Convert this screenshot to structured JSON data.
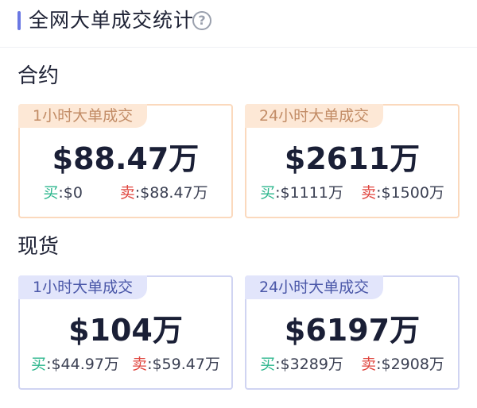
{
  "header": {
    "title": "全网大单成交统计",
    "help_icon": "question-circle-icon",
    "accent_color": "#6a78e3"
  },
  "sections": [
    {
      "title": "合约",
      "cards": [
        {
          "tag": "1小时大单成交",
          "value": "$88.47万",
          "buy_label": "买",
          "buy_value": ":$0",
          "sell_label": "卖",
          "sell_value": ":$88.47万"
        },
        {
          "tag": "24小时大单成交",
          "value": "$2611万",
          "buy_label": "买",
          "buy_value": ":$1111万",
          "sell_label": "卖",
          "sell_value": ":$1500万"
        }
      ]
    },
    {
      "title": "现货",
      "cards": [
        {
          "tag": "1小时大单成交",
          "value": "$104万",
          "buy_label": "买",
          "buy_value": ":$44.97万",
          "sell_label": "卖",
          "sell_value": ":$59.47万"
        },
        {
          "tag": "24小时大单成交",
          "value": "$6197万",
          "buy_label": "买",
          "buy_value": ":$3289万",
          "sell_label": "卖",
          "sell_value": ":$2908万"
        }
      ]
    }
  ],
  "colors": {
    "buy": "#2bb68c",
    "sell": "#e0463f",
    "contract_border": "#fbd9bd",
    "spot_border": "#d0d4f2"
  }
}
